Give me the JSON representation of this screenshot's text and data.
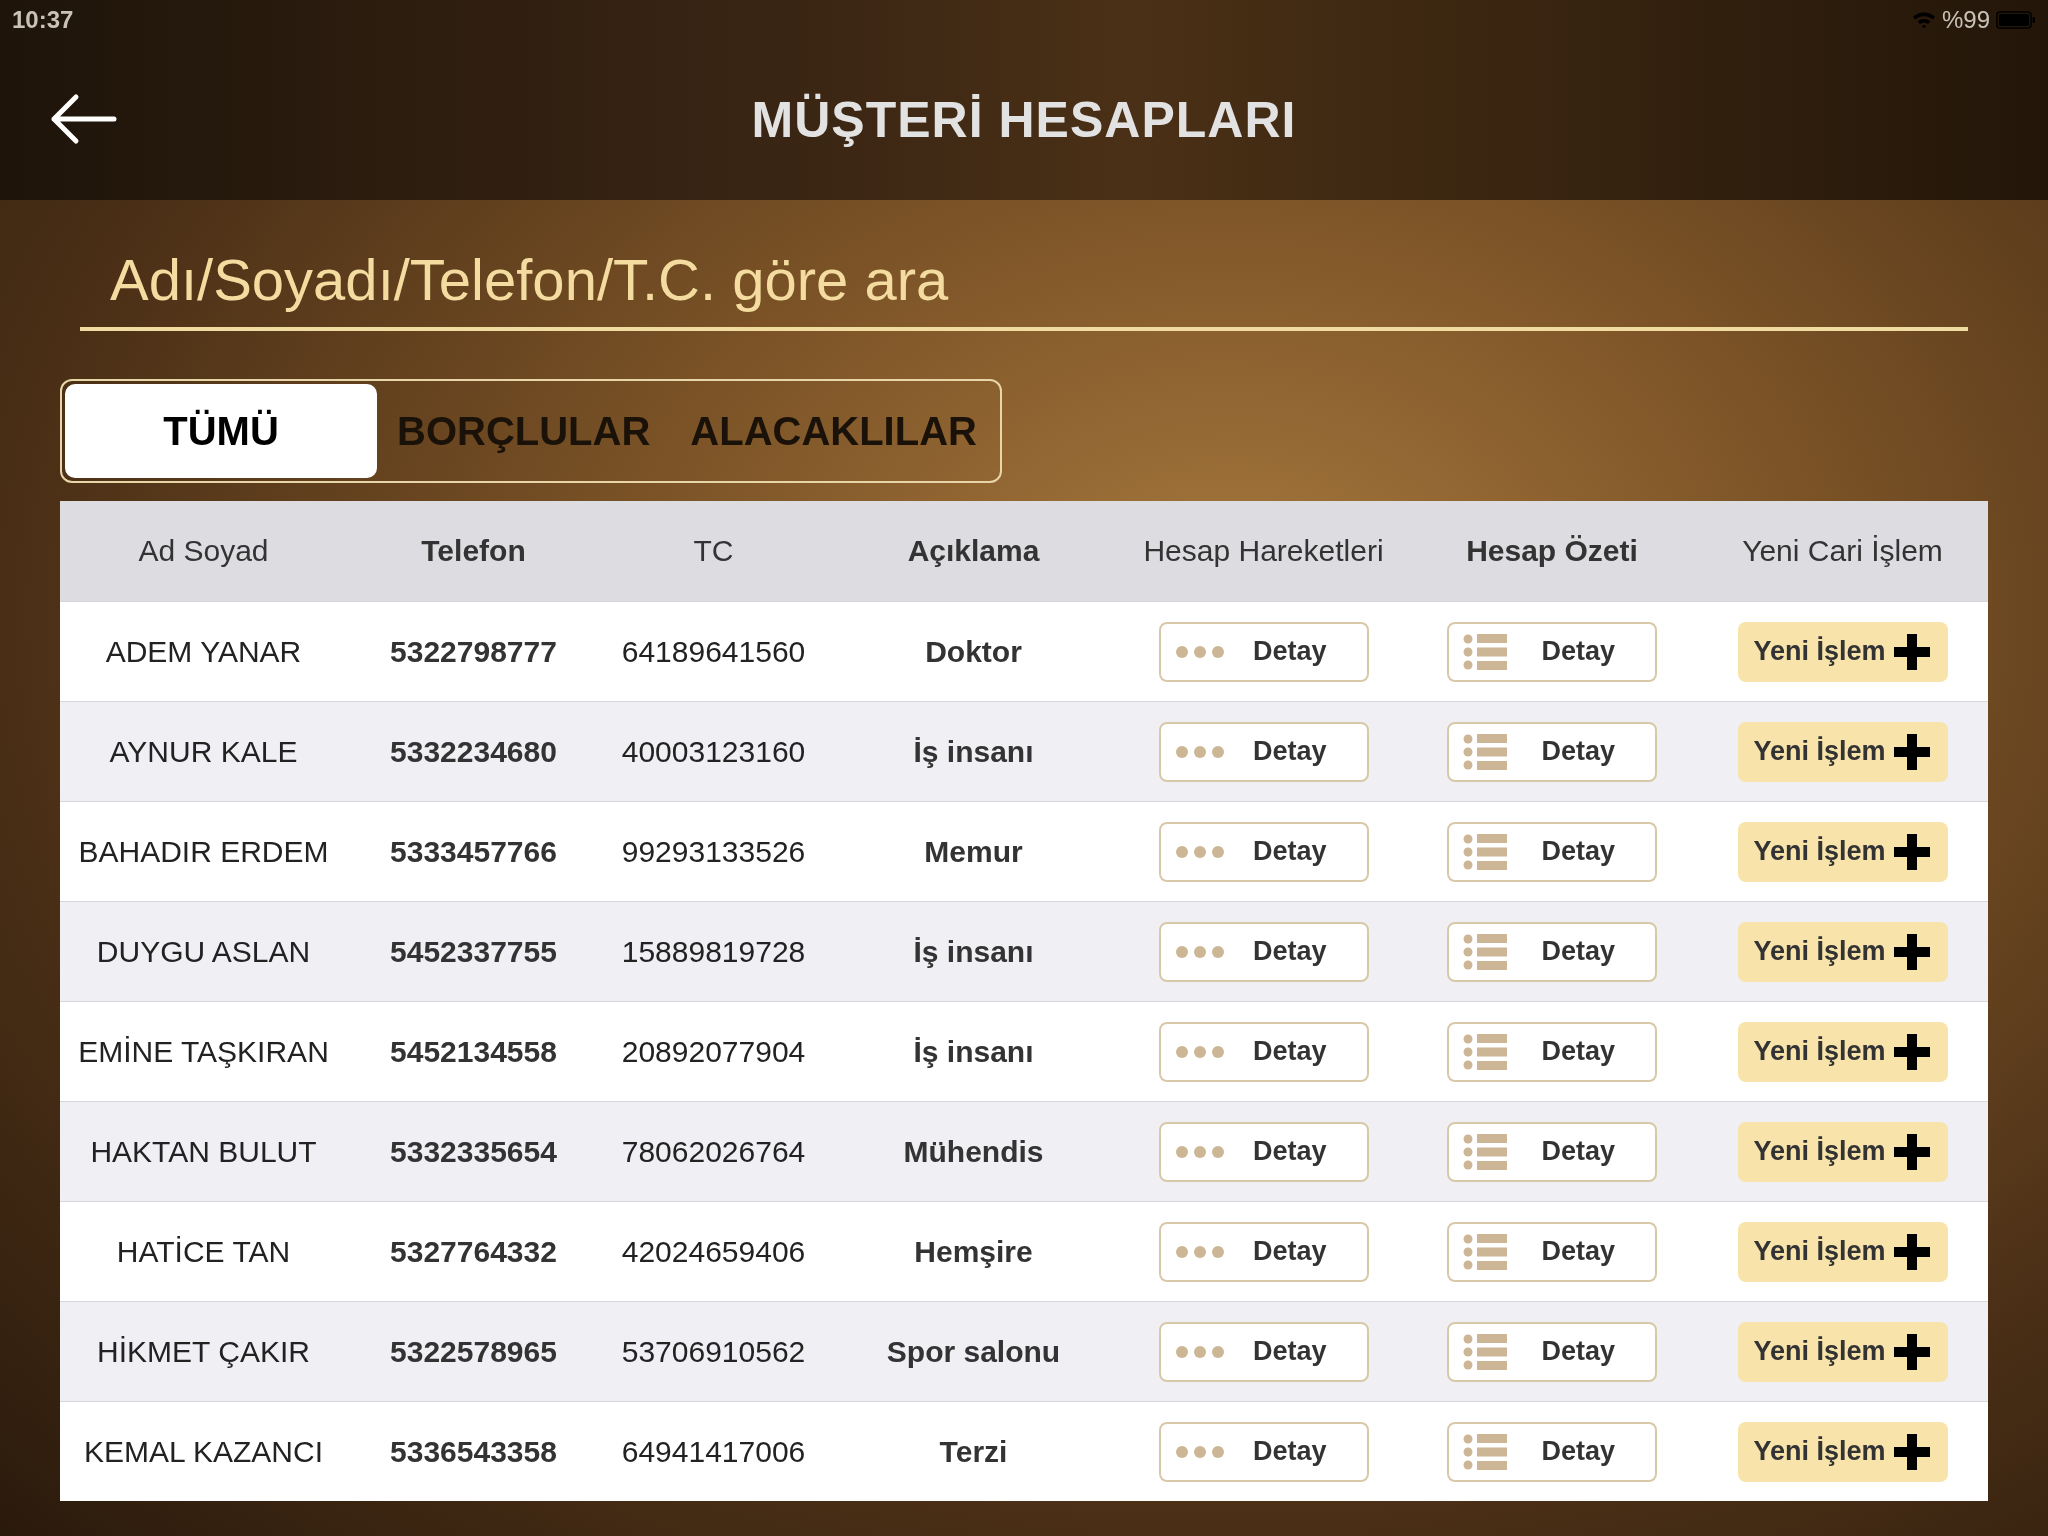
{
  "status_bar": {
    "time": "10:37",
    "battery": "%99"
  },
  "header": {
    "title": "MÜŞTERİ HESAPLARI"
  },
  "search": {
    "placeholder": "Adı/Soyadı/Telefon/T.C. göre ara"
  },
  "tabs": [
    {
      "label": "TÜMÜ",
      "selected": true
    },
    {
      "label": "BORÇLULAR",
      "selected": false
    },
    {
      "label": "ALACAKLILAR",
      "selected": false
    }
  ],
  "table": {
    "columns": [
      {
        "label": "Ad Soyad",
        "bold": false
      },
      {
        "label": "Telefon",
        "bold": true
      },
      {
        "label": "TC",
        "bold": false
      },
      {
        "label": "Açıklama",
        "bold": true
      },
      {
        "label": "Hesap Hareketleri",
        "bold": false
      },
      {
        "label": "Hesap Özeti",
        "bold": true
      },
      {
        "label": "Yeni Cari İşlem",
        "bold": false
      }
    ],
    "rows": [
      {
        "name": "ADEM YANAR",
        "phone": "5322798777",
        "tc": "64189641560",
        "note": "Doktor",
        "movements": "Detay",
        "summary": "Detay",
        "new_entry": "Yeni İşlem"
      },
      {
        "name": "AYNUR KALE",
        "phone": "5332234680",
        "tc": "40003123160",
        "note": "İş insanı",
        "movements": "Detay",
        "summary": "Detay",
        "new_entry": "Yeni İşlem"
      },
      {
        "name": "BAHADIR ERDEM",
        "phone": "5333457766",
        "tc": "99293133526",
        "note": "Memur",
        "movements": "Detay",
        "summary": "Detay",
        "new_entry": "Yeni İşlem"
      },
      {
        "name": "DUYGU ASLAN",
        "phone": "5452337755",
        "tc": "15889819728",
        "note": "İş insanı",
        "movements": "Detay",
        "summary": "Detay",
        "new_entry": "Yeni İşlem"
      },
      {
        "name": "EMİNE TAŞKIRAN",
        "phone": "5452134558",
        "tc": "20892077904",
        "note": "İş insanı",
        "movements": "Detay",
        "summary": "Detay",
        "new_entry": "Yeni İşlem"
      },
      {
        "name": "HAKTAN BULUT",
        "phone": "5332335654",
        "tc": "78062026764",
        "note": "Mühendis",
        "movements": "Detay",
        "summary": "Detay",
        "new_entry": "Yeni İşlem"
      },
      {
        "name": "HATİCE TAN",
        "phone": "5327764332",
        "tc": "42024659406",
        "note": "Hemşire",
        "movements": "Detay",
        "summary": "Detay",
        "new_entry": "Yeni İşlem"
      },
      {
        "name": "HİKMET ÇAKIR",
        "phone": "5322578965",
        "tc": "53706910562",
        "note": "Spor salonu",
        "movements": "Detay",
        "summary": "Detay",
        "new_entry": "Yeni İşlem"
      },
      {
        "name": "KEMAL KAZANCI",
        "phone": "5336543358",
        "tc": "64941417006",
        "note": "Terzi",
        "movements": "Detay",
        "summary": "Detay",
        "new_entry": "Yeni İşlem"
      }
    ]
  }
}
